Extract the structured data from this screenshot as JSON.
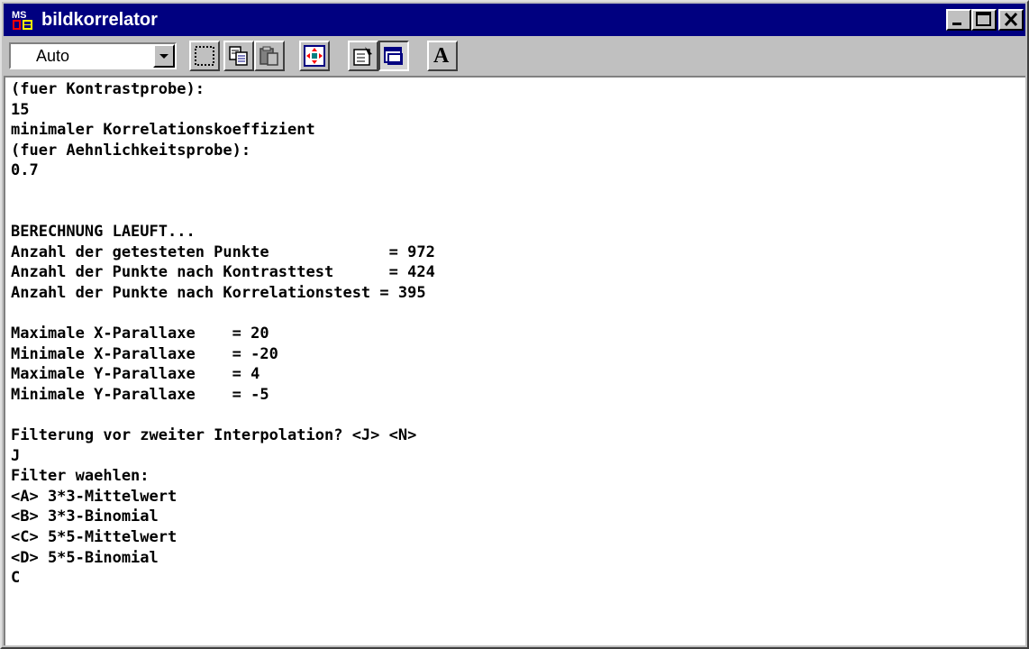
{
  "window": {
    "title": "bildkorrelator",
    "icon": "ms-dos-icon",
    "icon_text": "MS",
    "controls": [
      "minimize-icon",
      "maximize-icon",
      "close-icon"
    ]
  },
  "toolbar": {
    "font_size_select": {
      "value": "Auto"
    },
    "buttons": [
      {
        "id": "mark",
        "icon": "mark-icon"
      },
      {
        "id": "copy",
        "icon": "copy-icon"
      },
      {
        "id": "paste",
        "icon": "paste-icon"
      },
      {
        "id": "fullscreen",
        "icon": "fullscreen-icon"
      },
      {
        "id": "properties",
        "icon": "properties-icon"
      },
      {
        "id": "background",
        "icon": "background-icon",
        "pressed": true
      },
      {
        "id": "font",
        "icon": "font-icon",
        "label": "A"
      }
    ]
  },
  "console": {
    "lines": [
      "(fuer Kontrastprobe):",
      "15",
      "minimaler Korrelationskoeffizient",
      "(fuer Aehnlichkeitsprobe):",
      "0.7",
      "",
      "",
      "BERECHNUNG LAEUFT...",
      "Anzahl der getesteten Punkte             = 972",
      "Anzahl der Punkte nach Kontrasttest      = 424",
      "Anzahl der Punkte nach Korrelationstest = 395",
      "",
      "Maximale X-Parallaxe    = 20",
      "Minimale X-Parallaxe    = -20",
      "Maximale Y-Parallaxe    = 4",
      "Minimale Y-Parallaxe    = -5",
      "",
      "Filterung vor zweiter Interpolation? <J> <N>",
      "J",
      "Filter waehlen:",
      "<A> 3*3-Mittelwert",
      "<B> 3*3-Binomial",
      "<C> 5*5-Mittelwert",
      "<D> 5*5-Binomial",
      "C"
    ]
  },
  "colors": {
    "titlebar": "#000080",
    "title_text": "#ffffff",
    "chrome": "#c0c0c0",
    "console_bg": "#ffffff",
    "console_text": "#000000"
  }
}
